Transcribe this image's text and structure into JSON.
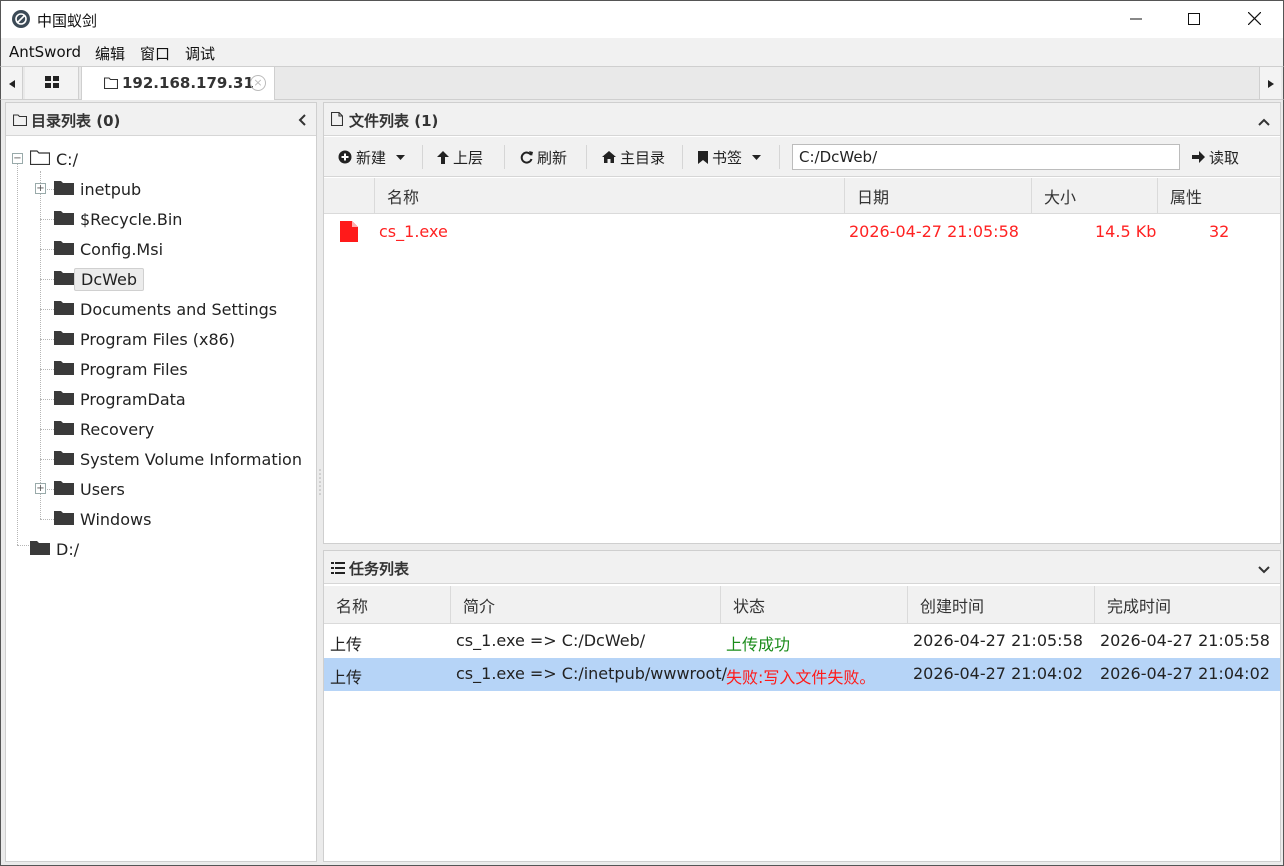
{
  "window": {
    "title": "中国蚁剑",
    "minimize_icon": "minimize-icon",
    "maximize_icon": "maximize-icon",
    "close_icon": "close-icon"
  },
  "menubar": {
    "items": [
      "AntSword",
      "编辑",
      "窗口",
      "调试"
    ]
  },
  "tabs": {
    "active_label": "192.168.179.31",
    "close_symbol": "×"
  },
  "directory_panel": {
    "title": "目录列表 (0)",
    "tree": [
      {
        "label": "C:/",
        "level": 0,
        "expanded": true
      },
      {
        "label": "inetpub",
        "level": 1,
        "expandable": true
      },
      {
        "label": "$Recycle.Bin",
        "level": 1
      },
      {
        "label": "Config.Msi",
        "level": 1
      },
      {
        "label": "DcWeb",
        "level": 1,
        "selected": true
      },
      {
        "label": "Documents and Settings",
        "level": 1
      },
      {
        "label": "Program Files (x86)",
        "level": 1
      },
      {
        "label": "Program Files",
        "level": 1
      },
      {
        "label": "ProgramData",
        "level": 1
      },
      {
        "label": "Recovery",
        "level": 1
      },
      {
        "label": "System Volume Information",
        "level": 1
      },
      {
        "label": "Users",
        "level": 1,
        "expandable": true
      },
      {
        "label": "Windows",
        "level": 1
      },
      {
        "label": "D:/",
        "level": 0
      }
    ]
  },
  "file_panel": {
    "title": "文件列表 (1)",
    "toolbar": {
      "new_label": "新建",
      "up_label": "上层",
      "refresh_label": "刷新",
      "home_label": "主目录",
      "bookmark_label": "书签",
      "path_value": "C:/DcWeb/",
      "read_label": "读取"
    },
    "columns": [
      "名称",
      "日期",
      "大小",
      "属性"
    ],
    "files": [
      {
        "name": "cs_1.exe",
        "date": "2026-04-27 21:05:58",
        "size": "14.5 Kb",
        "attr": "32"
      }
    ]
  },
  "task_panel": {
    "title": "任务列表",
    "columns": [
      "名称",
      "简介",
      "状态",
      "创建时间",
      "完成时间"
    ],
    "rows": [
      {
        "name": "上传",
        "desc": "cs_1.exe => C:/DcWeb/",
        "status": "上传成功",
        "status_type": "ok",
        "created": "2026-04-27 21:05:58",
        "finished": "2026-04-27 21:05:58"
      },
      {
        "name": "上传",
        "desc": "cs_1.exe => C:/inetpub/wwwroot/",
        "status": "失败:写入文件失败。",
        "status_type": "fail",
        "created": "2026-04-27 21:04:02",
        "finished": "2026-04-27 21:04:02"
      }
    ]
  },
  "colors": {
    "error_red": "#ff2222",
    "success_green": "#1a8c1a",
    "selection_blue": "#b6d4f7"
  }
}
